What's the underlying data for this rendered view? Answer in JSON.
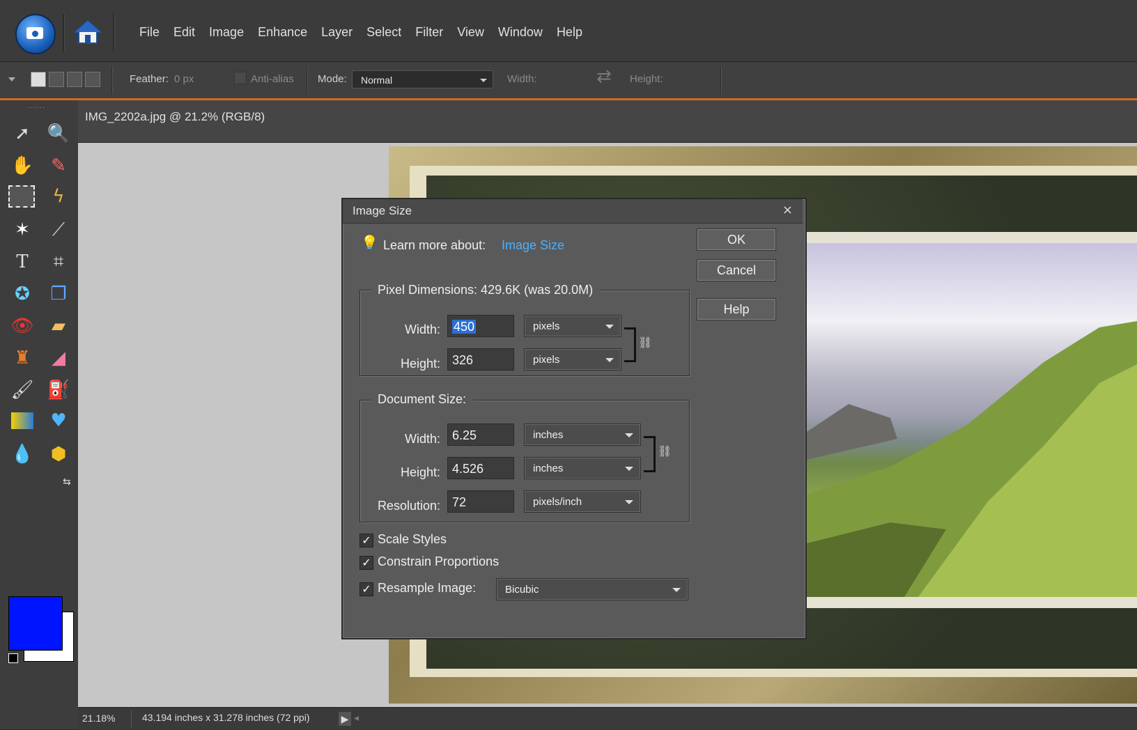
{
  "menu": {
    "items": [
      "File",
      "Edit",
      "Image",
      "Enhance",
      "Layer",
      "Select",
      "Filter",
      "View",
      "Window",
      "Help"
    ]
  },
  "options": {
    "feather_label": "Feather:",
    "feather_value": "0 px",
    "antialias_label": "Anti-alias",
    "mode_label": "Mode:",
    "mode_value": "Normal",
    "width_label": "Width:",
    "height_label": "Height:"
  },
  "document": {
    "title": "IMG_2202a.jpg @ 21.2% (RGB/8)"
  },
  "colors": {
    "foreground": "#0014ff",
    "background": "#ffffff",
    "accent": "#d66a1c"
  },
  "status": {
    "zoom": "21.18%",
    "doc_info": "43.194 inches x 31.278 inches (72 ppi)"
  },
  "dialog": {
    "title": "Image Size",
    "close": "×",
    "learn_more_label": "Learn more about:",
    "learn_more_link": "Image Size",
    "ok": "OK",
    "cancel": "Cancel",
    "help": "Help",
    "pixel_dims_title": "Pixel Dimensions:  429.6K (was 20.0M)",
    "pixel_width_label": "Width:",
    "pixel_width_value": "450",
    "pixel_width_unit": "pixels",
    "pixel_height_label": "Height:",
    "pixel_height_value": "326",
    "pixel_height_unit": "pixels",
    "doc_size_title": "Document Size:",
    "doc_width_label": "Width:",
    "doc_width_value": "6.25",
    "doc_width_unit": "inches",
    "doc_height_label": "Height:",
    "doc_height_value": "4.526",
    "doc_height_unit": "inches",
    "resolution_label": "Resolution:",
    "resolution_value": "72",
    "resolution_unit": "pixels/inch",
    "scale_styles": "Scale Styles",
    "constrain": "Constrain Proportions",
    "resample": "Resample Image:",
    "resample_method": "Bicubic"
  }
}
